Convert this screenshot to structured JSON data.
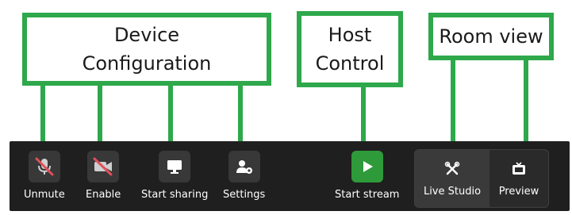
{
  "annotations": {
    "device_configuration": [
      "Device",
      "Configuration"
    ],
    "host_control": [
      "Host",
      "Control"
    ],
    "room_view": [
      "Room view"
    ]
  },
  "toolbar": {
    "unmute_label": "Unmute",
    "enable_label": "Enable",
    "start_sharing_label": "Start sharing",
    "settings_label": "Settings",
    "start_stream_label": "Start stream",
    "live_studio_label": "Live Studio",
    "preview_label": "Preview"
  },
  "icons": {
    "unmute": "microphone-muted-icon",
    "enable": "video-camera-off-icon",
    "start_sharing": "monitor-icon",
    "settings": "user-gear-icon",
    "start_stream": "play-icon",
    "live_studio": "tools-icon",
    "preview": "tv-icon"
  },
  "colors": {
    "annotation_green": "#2ea84b",
    "toolbar_bg": "#1f1f1f",
    "button_bg": "#383838",
    "stream_green": "#2e9a3a",
    "muted_red": "#e0505a"
  }
}
